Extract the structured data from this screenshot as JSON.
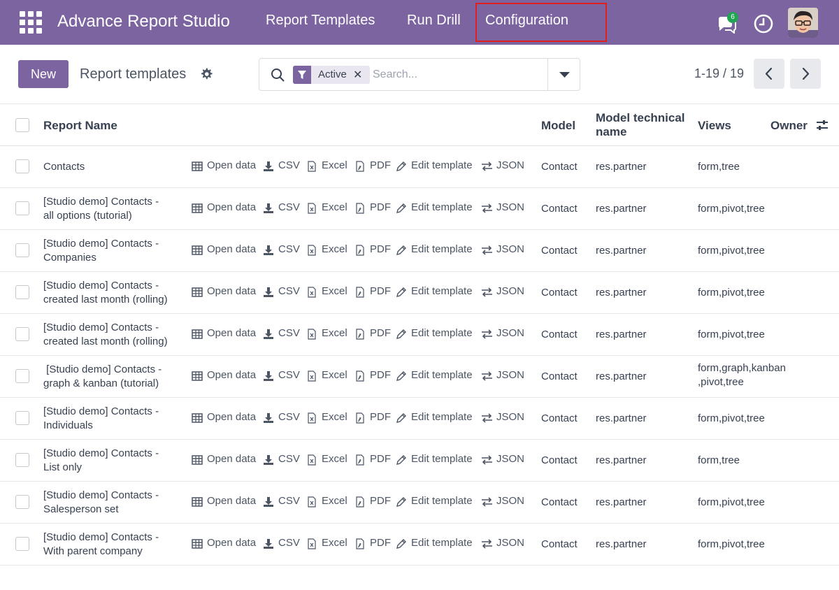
{
  "navbar": {
    "brand": "Advance Report Studio",
    "menu": [
      "Report Templates",
      "Run Drill",
      "Configuration"
    ],
    "chat_count": "6",
    "accent": "#7b64a0",
    "icons": [
      "apps-grid-icon",
      "chat-icon",
      "clock-icon",
      "avatar"
    ]
  },
  "control": {
    "new_label": "New",
    "breadcrumb": "Report templates",
    "facet_label": "Active",
    "facet_close": "✕",
    "search_placeholder": "Search...",
    "pager": "1-19 / 19"
  },
  "table": {
    "headers": {
      "name": "Report Name",
      "model": "Model",
      "model_tech_1": "Model technical",
      "model_tech_2": "name",
      "views": "Views",
      "owner": "Owner"
    },
    "actions": [
      "Open data",
      "CSV",
      "Excel",
      "PDF",
      "Edit template",
      "JSON"
    ],
    "rows": [
      {
        "name1": "Contacts",
        "name2": "",
        "model": "Contact",
        "tech": "res.partner",
        "views1": "form,tree",
        "views2": ""
      },
      {
        "name1": "[Studio demo] Contacts -",
        "name2": "all options (tutorial)",
        "model": "Contact",
        "tech": "res.partner",
        "views1": "form,pivot,tree",
        "views2": ""
      },
      {
        "name1": "[Studio demo] Contacts -",
        "name2": "Companies",
        "model": "Contact",
        "tech": "res.partner",
        "views1": "form,pivot,tree",
        "views2": ""
      },
      {
        "name1": "[Studio demo] Contacts -",
        "name2": "created last month (rolling)",
        "model": "Contact",
        "tech": "res.partner",
        "views1": "form,pivot,tree",
        "views2": ""
      },
      {
        "name1": "[Studio demo] Contacts -",
        "name2": "created last month (rolling)",
        "model": "Contact",
        "tech": "res.partner",
        "views1": "form,pivot,tree",
        "views2": ""
      },
      {
        "name1": " [Studio demo] Contacts -",
        "name2": "graph & kanban (tutorial)",
        "model": "Contact",
        "tech": "res.partner",
        "views1": "form,graph,kanban",
        "views2": ",pivot,tree"
      },
      {
        "name1": "[Studio demo] Contacts -",
        "name2": "Individuals",
        "model": "Contact",
        "tech": "res.partner",
        "views1": "form,pivot,tree",
        "views2": ""
      },
      {
        "name1": "[Studio demo] Contacts -",
        "name2": "List only",
        "model": "Contact",
        "tech": "res.partner",
        "views1": "form,tree",
        "views2": ""
      },
      {
        "name1": "[Studio demo] Contacts -",
        "name2": "Salesperson set",
        "model": "Contact",
        "tech": "res.partner",
        "views1": "form,pivot,tree",
        "views2": ""
      },
      {
        "name1": "[Studio demo] Contacts -",
        "name2": "With parent company",
        "model": "Contact",
        "tech": "res.partner",
        "views1": "form,pivot,tree",
        "views2": ""
      }
    ]
  }
}
